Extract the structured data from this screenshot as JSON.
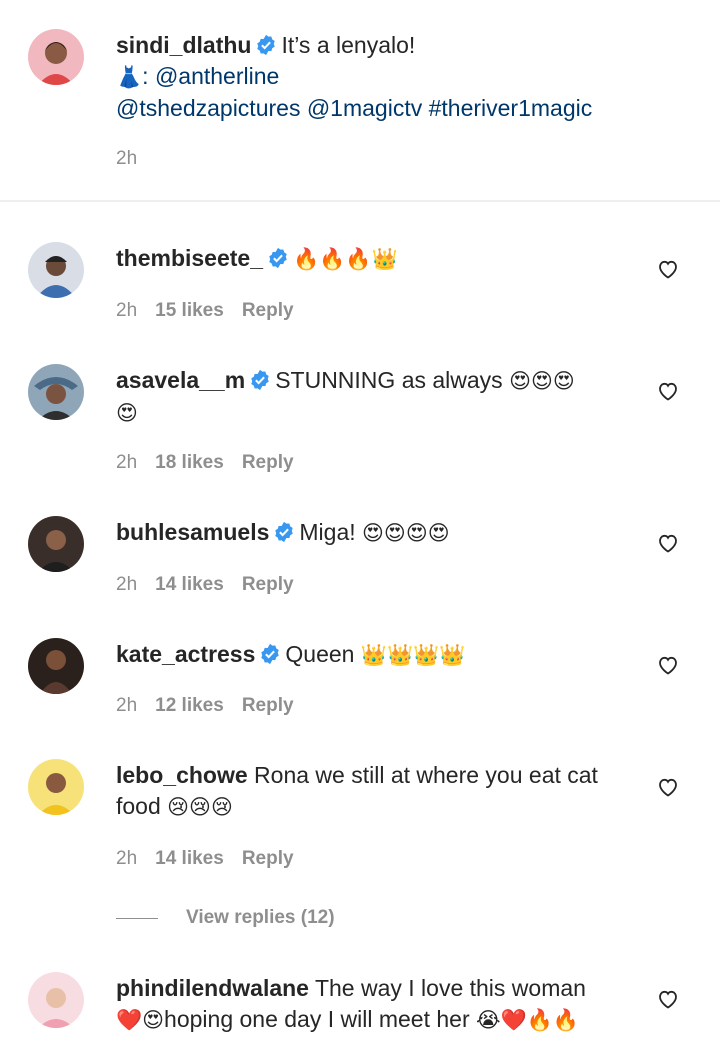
{
  "caption": {
    "username": "sindi_dlathu",
    "text": "It’s a lenyalo!",
    "line2_emoji": "👗",
    "line2_sep": ": ",
    "line2_link": "@antherline",
    "line3": "@tshedzapictures @1magictv #theriver1magic",
    "time": "2h",
    "avatar_color": "#e8a0a8"
  },
  "comments": [
    {
      "username": "thembiseete_",
      "verified": true,
      "text": "",
      "emoji": "🔥🔥🔥👑",
      "time": "2h",
      "likes": "15 likes",
      "reply": "Reply",
      "avatar_color": "#6b8fb5"
    },
    {
      "username": "asavela__m",
      "verified": true,
      "text": "STUNNING as always ",
      "emoji": "😍😍😍",
      "line2_emoji": "😍",
      "time": "2h",
      "likes": "18 likes",
      "reply": "Reply",
      "avatar_color": "#7a6a5a"
    },
    {
      "username": "buhlesamuels",
      "verified": true,
      "text": "Miga! ",
      "emoji": "😍😍😍😍",
      "time": "2h",
      "likes": "14 likes",
      "reply": "Reply",
      "avatar_color": "#4a3a32"
    },
    {
      "username": "kate_actress",
      "verified": true,
      "text": "Queen ",
      "emoji": "👑👑👑👑",
      "time": "2h",
      "likes": "12 likes",
      "reply": "Reply",
      "avatar_color": "#3a2a24"
    },
    {
      "username": "lebo_chowe",
      "verified": false,
      "text": "Rona we still at where you eat cat",
      "line2_text": "food ",
      "emoji": "😢😢😢",
      "time": "2h",
      "likes": "14 likes",
      "reply": "Reply",
      "avatar_color": "#f2d34a"
    },
    {
      "username": "phindilendwalane",
      "verified": false,
      "text": "The way I love this woman",
      "line2_emoji_a": "❤️😍",
      "line2_text": "hoping one day I will meet her ",
      "line2_emoji_b": "😭❤️🔥🔥",
      "avatar_color": "#f4c9d0"
    }
  ],
  "view_replies": "View replies (12)",
  "colors": {
    "link": "#00376b",
    "meta": "#8e8e8e",
    "verified": "#3897f0"
  }
}
